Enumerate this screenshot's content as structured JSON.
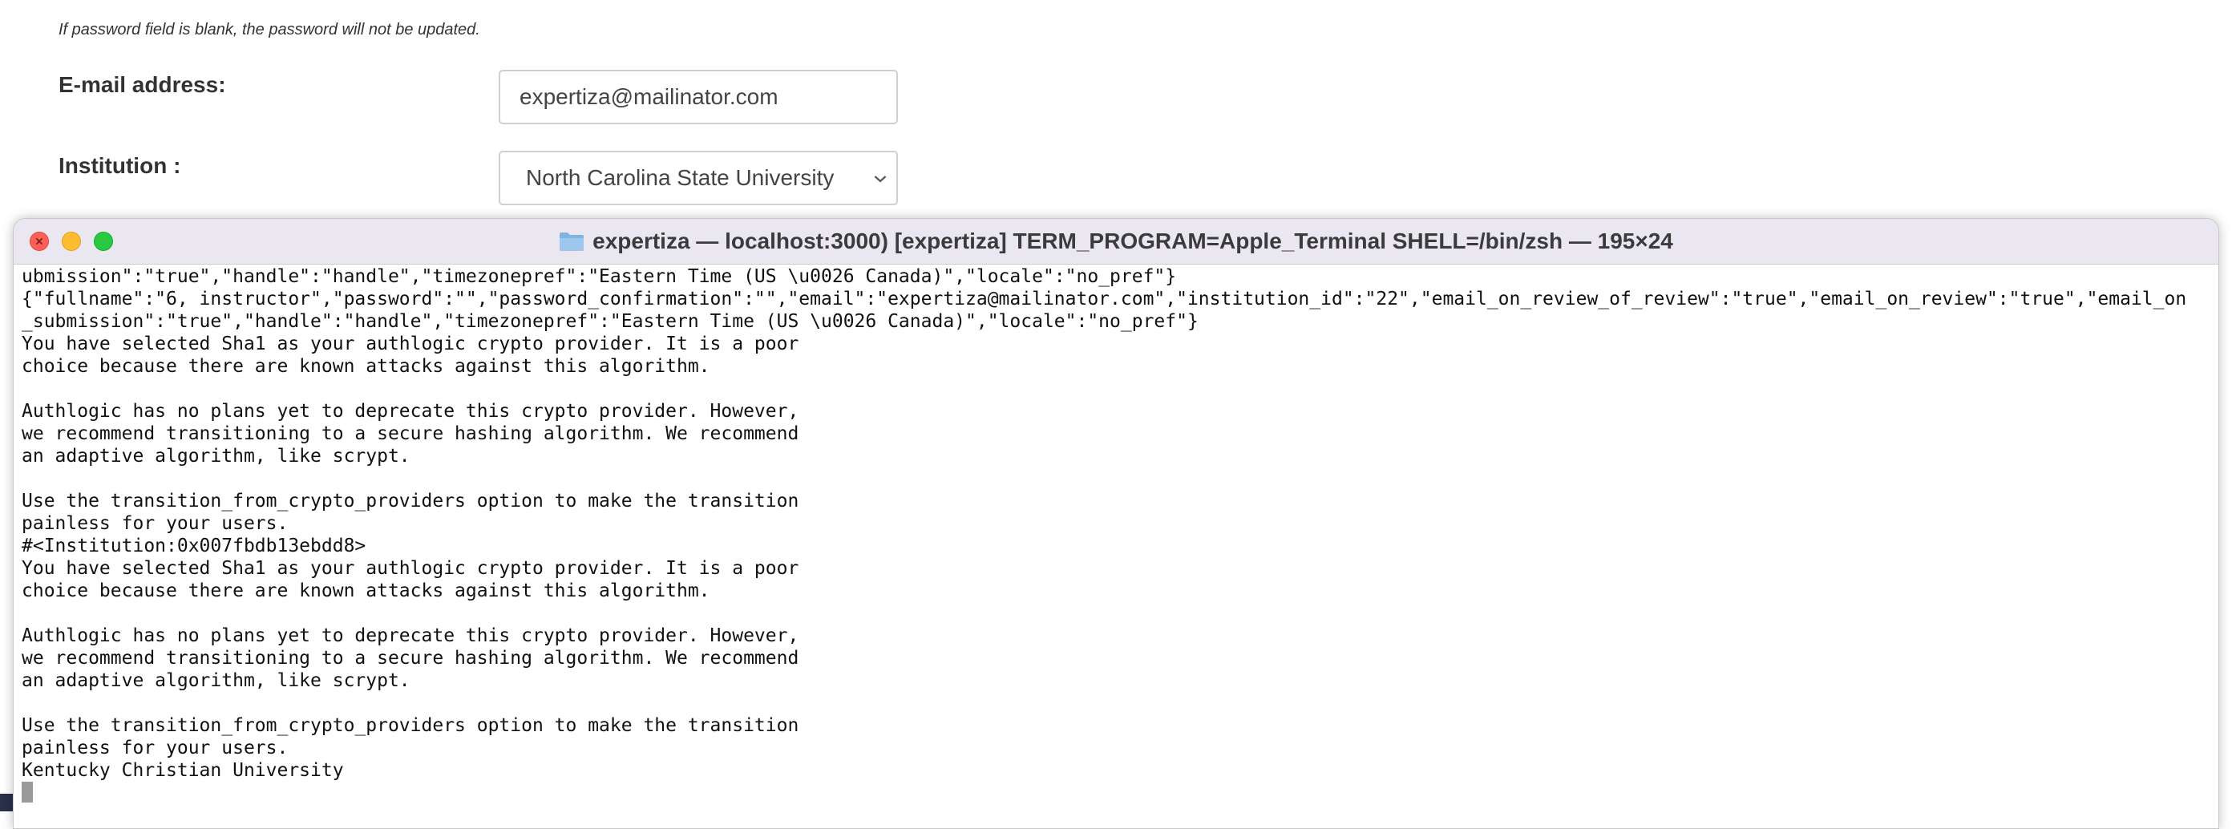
{
  "form": {
    "password_note": "If password field is blank, the password will not be updated.",
    "email_label": "E-mail address:",
    "email_value": "expertiza@mailinator.com",
    "institution_label": "Institution :",
    "institution_value": "North Carolina State University"
  },
  "terminal": {
    "title": "expertiza — localhost:3000) [expertiza] TERM_PROGRAM=Apple_Terminal SHELL=/bin/zsh — 195×24",
    "lines": [
      "ubmission\":\"true\",\"handle\":\"handle\",\"timezonepref\":\"Eastern Time (US \\u0026 Canada)\",\"locale\":\"no_pref\"}",
      "{\"fullname\":\"6, instructor\",\"password\":\"\",\"password_confirmation\":\"\",\"email\":\"expertiza@mailinator.com\",\"institution_id\":\"22\",\"email_on_review_of_review\":\"true\",\"email_on_review\":\"true\",\"email_on",
      "_submission\":\"true\",\"handle\":\"handle\",\"timezonepref\":\"Eastern Time (US \\u0026 Canada)\",\"locale\":\"no_pref\"}",
      "You have selected Sha1 as your authlogic crypto provider. It is a poor",
      "choice because there are known attacks against this algorithm.",
      "",
      "Authlogic has no plans yet to deprecate this crypto provider. However,",
      "we recommend transitioning to a secure hashing algorithm. We recommend",
      "an adaptive algorithm, like scrypt.",
      "",
      "Use the transition_from_crypto_providers option to make the transition",
      "painless for your users.",
      "#<Institution:0x007fbdb13ebdd8>",
      "You have selected Sha1 as your authlogic crypto provider. It is a poor",
      "choice because there are known attacks against this algorithm.",
      "",
      "Authlogic has no plans yet to deprecate this crypto provider. However,",
      "we recommend transitioning to a secure hashing algorithm. We recommend",
      "an adaptive algorithm, like scrypt.",
      "",
      "Use the transition_from_crypto_providers option to make the transition",
      "painless for your users.",
      "Kentucky Christian University"
    ]
  },
  "colors": {
    "close": "#fe5f57",
    "minimize": "#febc2e",
    "maximize": "#28c840",
    "titlebar": "#ebe7f1",
    "folder": "#7fb3e0"
  },
  "icons": {
    "title_icon": "folder-icon",
    "select_icon": "chevron-down-icon"
  }
}
